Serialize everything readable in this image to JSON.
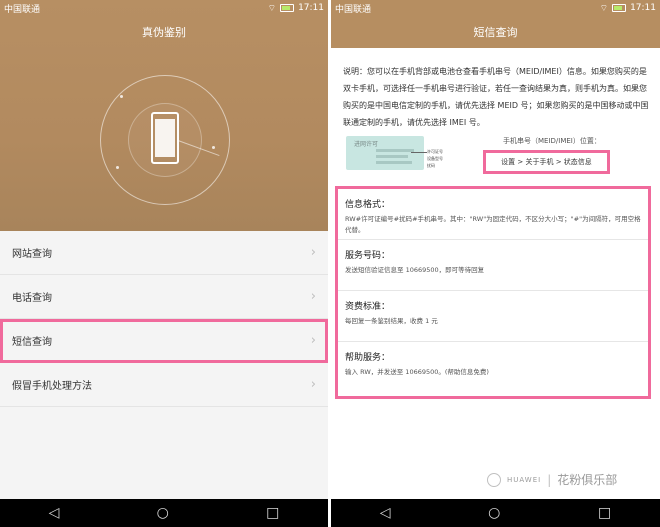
{
  "left": {
    "status": {
      "carrier": "中国联通",
      "time": "17:11"
    },
    "title": "真伪鉴别",
    "menu": [
      {
        "label": "网站查询"
      },
      {
        "label": "电话查询"
      },
      {
        "label": "短信查询"
      },
      {
        "label": "假冒手机处理方法"
      }
    ]
  },
  "right": {
    "status": {
      "carrier": "中国联通",
      "time": "17:11"
    },
    "title": "短信查询",
    "description": "说明：您可以在手机背部或电池仓查看手机串号（MEID/IMEI）信息。如果您购买的是双卡手机，可选择任一手机串号进行验证，若任一查询结果为真，则手机为真。如果您购买的是中国电信定制的手机，请优先选择 MEID 号；如果您购买的是中国移动或中国联通定制的手机，请优先选择 IMEI 号。",
    "card_title": "进网许可",
    "card_labels": [
      "许可证号",
      "设备型号",
      "扰码"
    ],
    "imei_label": "手机串号（MEID/IMEI）位置：",
    "settings_path": "设置 > 关于手机 > 状态信息",
    "sections": [
      {
        "heading": "信息格式：",
        "body": "RW#许可证编号#扰码#手机串号。其中：\"RW\"为固定代码，不区分大小写；\"#\"为间隔符，可用空格代替。"
      },
      {
        "heading": "服务号码：",
        "body": "发送短信验证信息至 10669500，即可等待回复"
      },
      {
        "heading": "资费标准：",
        "body": "每回复一条鉴别结果，收费 1 元"
      },
      {
        "heading": "帮助服务：",
        "body": "输入 RW，并发送至 10669500。(帮助信息免费)"
      }
    ]
  },
  "watermark": {
    "brand": "HUAWEI",
    "text": "花粉俱乐部"
  },
  "nav": {
    "back": "◁",
    "home": "○",
    "recent": "□"
  },
  "colors": {
    "brown": "#b68e61",
    "highlight": "#f06a9c"
  }
}
